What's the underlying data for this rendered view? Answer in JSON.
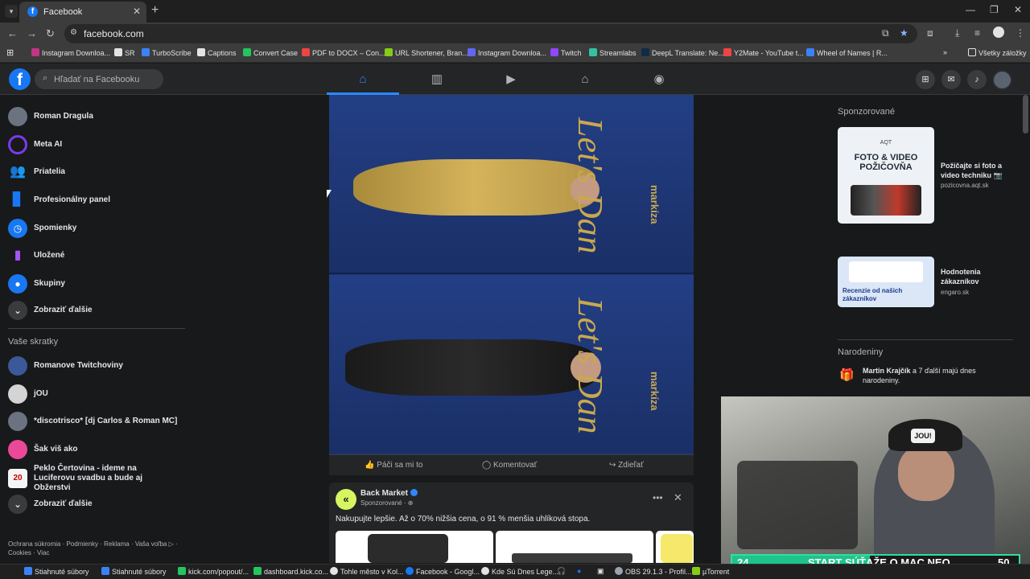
{
  "browser": {
    "tab_title": "Facebook",
    "tab_close": "✕",
    "new_tab": "+",
    "url": "facebook.com",
    "all_bookmarks": "Všetky záložky",
    "bookmarks": [
      {
        "label": "Instagram Downloa...",
        "color": "#c13584"
      },
      {
        "label": "SR",
        "color": "#e3e3e3"
      },
      {
        "label": "TurboScribe",
        "color": "#3b82f6"
      },
      {
        "label": "Captions",
        "color": "#e3e3e3"
      },
      {
        "label": "Convert Case",
        "color": "#22c55e"
      },
      {
        "label": "PDF to DOCX – Con...",
        "color": "#ef4444"
      },
      {
        "label": "URL Shortener, Bran...",
        "color": "#84cc16"
      },
      {
        "label": "Instagram Downloa...",
        "color": "#6366f1"
      },
      {
        "label": "Twitch",
        "color": "#9146ff"
      },
      {
        "label": "Streamlabs",
        "color": "#31c3a2"
      },
      {
        "label": "DeepL Translate: Ne...",
        "color": "#0f2b46"
      },
      {
        "label": "Y2Mate - YouTube t...",
        "color": "#ef4444"
      },
      {
        "label": "Wheel of Names | R...",
        "color": "#3b82f6"
      }
    ]
  },
  "fb": {
    "search_placeholder": "Hľadať na Facebooku",
    "nav_icons": [
      "home-icon",
      "reels-icon",
      "video-icon",
      "marketplace-icon",
      "groups-icon"
    ],
    "sidebar": [
      {
        "label": "Roman Dragula",
        "icon": "avatar",
        "color": "#6b7280"
      },
      {
        "label": "Meta AI",
        "icon": "meta-ai-icon",
        "color": "#7c3aed"
      },
      {
        "label": "Priatelia",
        "icon": "friends-icon",
        "color": "#1877f2"
      },
      {
        "label": "Profesionálny panel",
        "icon": "dashboard-icon",
        "color": "#1877f2"
      },
      {
        "label": "Spomienky",
        "icon": "memories-icon",
        "color": "#1877f2"
      },
      {
        "label": "Uložené",
        "icon": "saved-icon",
        "color": "#a855f7"
      },
      {
        "label": "Skupiny",
        "icon": "groups-icon",
        "color": "#1877f2"
      },
      {
        "label": "Zobraziť ďalšie",
        "icon": "chevron-down-icon",
        "color": "#3a3b3c"
      }
    ],
    "shortcuts_title": "Vaše skratky",
    "shortcuts": [
      {
        "label": "Romanove Twitchoviny",
        "color": "#3b5998"
      },
      {
        "label": "jOU",
        "color": "#d4d4d4"
      },
      {
        "label": "*discotrisco* [dj Carlos & Roman MC]",
        "color": "#6b7280"
      },
      {
        "label": "Šak viš ako",
        "color": "#ec4899"
      },
      {
        "label": "Peklo Čertovina - ideme na Luciferovu svadbu a bude aj Obžerstvi",
        "color": "#f5f5f5",
        "badge": "20"
      },
      {
        "label": "Zobraziť ďalšie",
        "color": "#3a3b3c"
      }
    ],
    "footer": "Ochrana súkromia · Podmienky · Reklama · Vaša voľba ▷ · Cookies · Viac",
    "post1": {
      "backdrop_text": "Let's Dan",
      "brand": "markíza",
      "like": "Páči sa mi to",
      "comment": "Komentovať",
      "share": "Zdieľať"
    },
    "post2": {
      "avatar_letter": "«",
      "name": "Back Market",
      "sponsored": "Sponzorované · ⊕",
      "text": "Nakupujte lepšie. Až o 70% nižšia cena, o 91 % menšia uhlíková stopa.",
      "more": "•••",
      "close": "✕"
    },
    "right": {
      "sponsored_title": "Sponzorované",
      "ads": [
        {
          "title": "Požičajte si foto a video techniku 📷",
          "url": "pozicovna.aqt.sk",
          "image_text": "FOTO & VIDEO POŽIČOVŇA",
          "brand": "AQT"
        },
        {
          "title": "Hodnotenia zákazníkov",
          "url": "engaro.sk",
          "image_text": "Recenzie od našich zákazníkov"
        }
      ],
      "birthdays_title": "Narodeniny",
      "birthday_name": "Martin Krajčík",
      "birthday_rest": " a 7 ďalší majú dnes narodeniny."
    }
  },
  "cam": {
    "left_number": "24",
    "text": "START SÚŤAŽE O MAC NEO",
    "right_number": "50",
    "progress": 0.48,
    "cap_logo": "JOU!"
  },
  "taskbar": [
    {
      "label": "Stiahnuté súbory",
      "color": "#3b82f6"
    },
    {
      "label": "Stiahnuté súbory",
      "color": "#3b82f6"
    },
    {
      "label": "kick.com/popout/...",
      "color": "#22c55e"
    },
    {
      "label": "dashboard.kick.co...",
      "color": "#22c55e"
    },
    {
      "label": "Tohle město v Kol...",
      "color": "#e3e3e3"
    },
    {
      "label": "Facebook - Googl...",
      "color": "#1877f2"
    },
    {
      "label": "Kde Sú Dnes Lege...",
      "color": "#e3e3e3"
    },
    {
      "label": "OBS 29.1.3 - Profil...",
      "color": "#9ca3af"
    },
    {
      "label": "µTorrent",
      "color": "#84cc16"
    }
  ]
}
